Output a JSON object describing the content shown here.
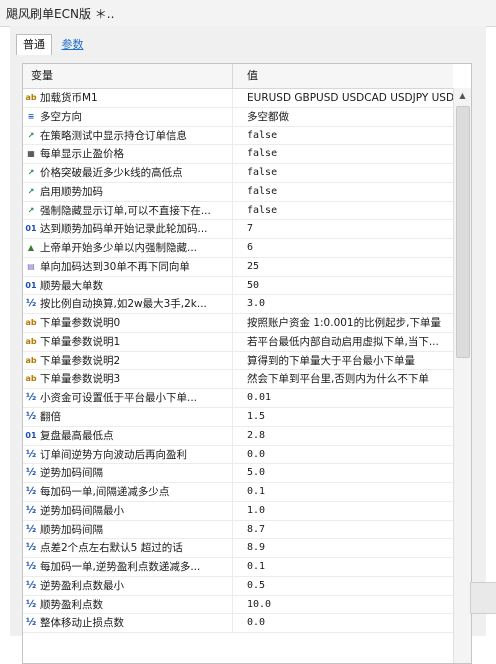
{
  "window": {
    "title": "飓风刷单ECN版 ＊.."
  },
  "tabs": [
    {
      "label": "普通",
      "active": true
    },
    {
      "label": "参数",
      "active": false
    }
  ],
  "grid": {
    "columns": [
      "变量",
      "值"
    ],
    "rows": [
      {
        "icon": "ab",
        "icon_name": "text-icon",
        "label": "加载货币M1",
        "value": "EURUSD GBPUSD USDCAD USDJPY USDC..."
      },
      {
        "icon": "≡",
        "icon_name": "enum-icon",
        "label": "多空方向",
        "value": "多空都做"
      },
      {
        "icon": "↗",
        "icon_name": "bool-icon",
        "label": "在策略测试中显示持仓订单信息",
        "value": "false"
      },
      {
        "icon": "▦",
        "icon_name": "color-icon",
        "label": "每单显示止盈价格",
        "value": "false"
      },
      {
        "icon": "↗",
        "icon_name": "bool-icon",
        "label": "价格突破最近多少k线的高低点",
        "value": "false"
      },
      {
        "icon": "↗",
        "icon_name": "bool-icon",
        "label": "启用顺势加码",
        "value": "false"
      },
      {
        "icon": "↗",
        "icon_name": "bool-icon",
        "label": "强制隐藏显示订单,可以不直接下在...",
        "value": "false"
      },
      {
        "icon": "01",
        "icon_name": "integer-icon",
        "label": "达到顺势加码单开始记录此轮加码...",
        "value": "7"
      },
      {
        "icon": "▲",
        "icon_name": "timeframe-icon",
        "label": "上帝单开始多少单以内强制隐藏...",
        "value": "6"
      },
      {
        "icon": "▤",
        "icon_name": "datetime-icon",
        "label": "单向加码达到30单不再下同向单",
        "value": "25"
      },
      {
        "icon": "01",
        "icon_name": "integer-icon",
        "label": "顺势最大单数",
        "value": "50"
      },
      {
        "icon": "½",
        "icon_name": "double-icon",
        "label": "按比例自动换算,如2w最大3手,2k...",
        "value": "3.0"
      },
      {
        "icon": "ab",
        "icon_name": "text-icon",
        "label": "下单量参数说明0",
        "value": "按照账户资金 1:0.001的比例起步,下单量"
      },
      {
        "icon": "ab",
        "icon_name": "text-icon",
        "label": "下单量参数说明1",
        "value": "若平台最低内部自动启用虚拟下单,当下...",
        "text_style": true
      },
      {
        "icon": "ab",
        "icon_name": "text-icon",
        "label": "下单量参数说明2",
        "value": "算得到的下单量大于平台最小下单量"
      },
      {
        "icon": "ab",
        "icon_name": "text-icon",
        "label": "下单量参数说明3",
        "value": "然会下单到平台里,否则内为什么不下单"
      },
      {
        "icon": "½",
        "icon_name": "double-icon",
        "label": "小资金可设置低于平台最小下单...",
        "value": "0.01"
      },
      {
        "icon": "½",
        "icon_name": "double-icon",
        "label": "翻倍",
        "value": "1.5"
      },
      {
        "icon": "01",
        "icon_name": "integer-icon",
        "label": "复盘最高最低点",
        "value": "2.8"
      },
      {
        "icon": "½",
        "icon_name": "double-icon",
        "label": "订单间逆势方向波动后再向盈利",
        "value": "0.0"
      },
      {
        "icon": "½",
        "icon_name": "double-icon",
        "label": "逆势加码间隔",
        "value": "5.0"
      },
      {
        "icon": "½",
        "icon_name": "double-icon",
        "label": "每加码一单,间隔递减多少点",
        "value": "0.1"
      },
      {
        "icon": "½",
        "icon_name": "double-icon",
        "label": "逆势加码间隔最小",
        "value": "1.0"
      },
      {
        "icon": "½",
        "icon_name": "double-icon",
        "label": "顺势加码间隔",
        "value": "8.7"
      },
      {
        "icon": "½",
        "icon_name": "double-icon",
        "label": "点差2个点左右默认5 超过的话",
        "value": "8.9"
      },
      {
        "icon": "½",
        "icon_name": "double-icon",
        "label": "每加码一单,逆势盈利点数递减多...",
        "value": "0.1"
      },
      {
        "icon": "½",
        "icon_name": "double-icon",
        "label": "逆势盈利点数最小",
        "value": "0.5"
      },
      {
        "icon": "½",
        "icon_name": "double-icon",
        "label": "顺势盈利点数",
        "value": "10.0"
      },
      {
        "icon": "½",
        "icon_name": "double-icon",
        "label": "整体移动止损点数",
        "value": "0.0"
      }
    ]
  },
  "scrollbar": {
    "up_glyph": "▲"
  },
  "side_button": {
    "label": ""
  }
}
